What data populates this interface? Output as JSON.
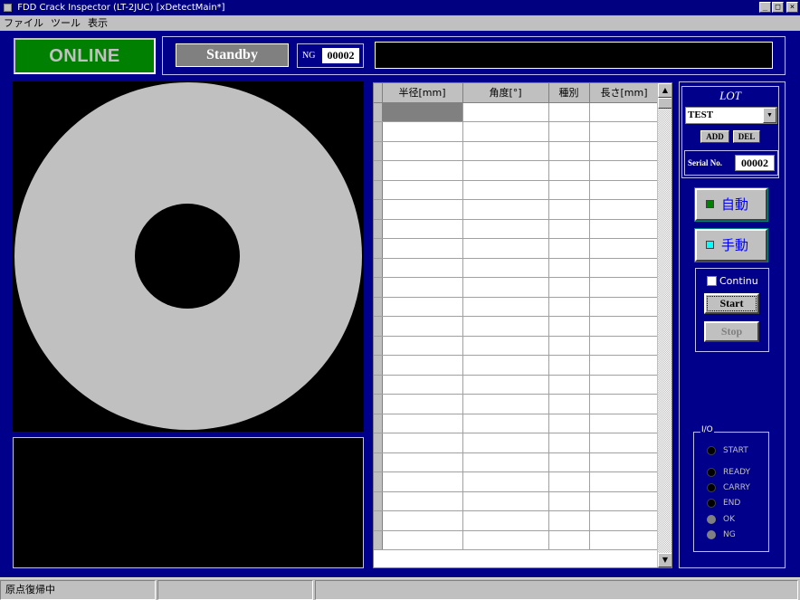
{
  "window": {
    "title": "FDD Crack Inspector (LT-2JUC) [xDetectMain*]",
    "minimize": "_",
    "maximize": "□",
    "close": "×"
  },
  "menu": [
    "ファイル",
    "ツール",
    "表示"
  ],
  "header": {
    "online_label": "ONLINE",
    "state_label": "Standby",
    "ng_label": "NG",
    "ng_count": "00002",
    "message": ""
  },
  "grid": {
    "columns": [
      "半径[mm]",
      "角度[°]",
      "種別",
      "長さ[mm]"
    ],
    "row_count": 23,
    "scroll_up": "▲",
    "scroll_down": "▼"
  },
  "lot": {
    "title": "LOT",
    "value": "TEST",
    "dropdown": "▼",
    "add_label": "ADD",
    "del_label": "DEL",
    "serial_label": "Serial No.",
    "serial_value": "00002"
  },
  "modes": {
    "auto_label": "自動",
    "manual_label": "手動",
    "auto_led_color": "#008000",
    "manual_led_color": "#00ffff"
  },
  "control": {
    "continue_label": "Continu",
    "start_label": "Start",
    "stop_label": "Stop"
  },
  "io": {
    "title": "I/O",
    "signals": [
      "START",
      "READY",
      "CARRY",
      "END",
      "OK",
      "NG"
    ]
  },
  "status": {
    "pane1": "原点復帰中",
    "pane2": "",
    "pane3": ""
  },
  "colors": {
    "background": "#00008b",
    "disk": "#c0c0c0",
    "online": "#008000"
  }
}
